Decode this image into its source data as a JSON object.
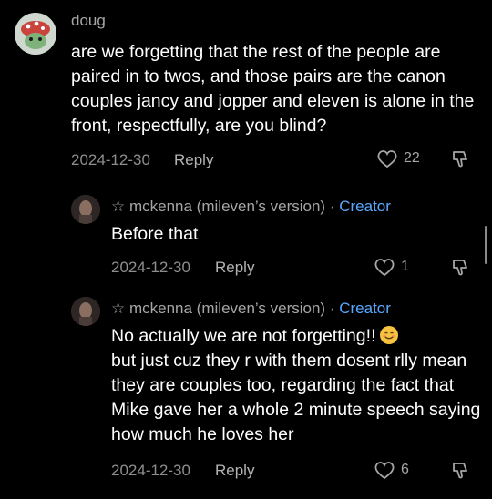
{
  "comments": [
    {
      "author": "doug",
      "text": "are we forgetting that the rest of the people are paired in to twos, and those pairs are the canon couples jancy and jopper and eleven is alone in the front, respectfully, are you blind?",
      "date": "2024-12-30",
      "reply_label": "Reply",
      "likes": "22"
    },
    {
      "star": "☆",
      "author": "mckenna (mileven’s version)",
      "separator": "·",
      "badge": "Creator",
      "text": "Before that",
      "date": "2024-12-30",
      "reply_label": "Reply",
      "likes": "1"
    },
    {
      "star": "☆",
      "author": "mckenna (mileven’s version)",
      "separator": "·",
      "badge": "Creator",
      "text_line1": "No actually we are not forgetting!!",
      "text_rest": "but just cuz they r with them dosent rlly mean they are couples too, regarding the fact that Mike gave her a whole 2 minute speech saying how much he loves her",
      "date": "2024-12-30",
      "reply_label": "Reply",
      "likes": "6"
    }
  ],
  "icons": {
    "like": "heart-outline-icon",
    "dislike": "thumbs-down-icon",
    "emoji": "smiling-face-emoji"
  },
  "colors": {
    "creator": "#5aa9ff",
    "meta": "#8e8e8e",
    "background": "#000000"
  }
}
